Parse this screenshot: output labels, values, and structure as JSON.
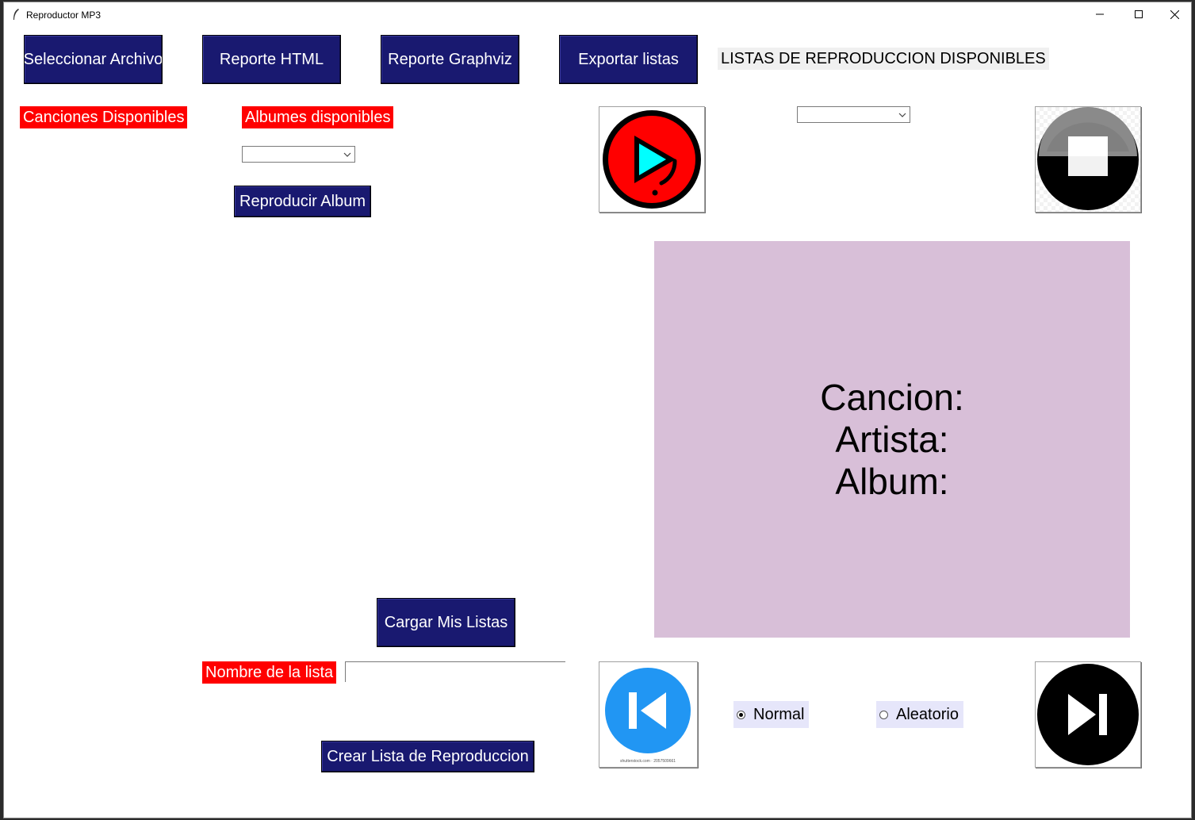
{
  "window": {
    "title": "Reproductor MP3",
    "controls": {
      "minimize": "—",
      "maximize": "☐",
      "close": "✕"
    }
  },
  "toolbar": {
    "select_file": "Seleccionar Archivo",
    "html_report": "Reporte HTML",
    "graphviz_report": "Reporte Graphviz",
    "export_lists": "Exportar listas"
  },
  "playlists_header": "LISTAS DE REPRODUCCION DISPONIBLES",
  "songs_label": "Canciones Disponibles",
  "albums_label": "Albumes disponibles",
  "albums_combo_value": "",
  "playlists_combo_value": "",
  "play_album_button": "Reproducir Album",
  "now_playing": {
    "song_label": "Cancion:",
    "artist_label": "Artista:",
    "album_label": "Album:"
  },
  "load_lists_button": "Cargar Mis Listas",
  "list_name_label": "Nombre de la lista",
  "list_name_value": "",
  "create_list_button": "Crear Lista de Reproduccion",
  "mode": {
    "normal_label": "Normal",
    "random_label": "Aleatorio",
    "selected": "normal"
  },
  "prev_image_caption": "shutterstock.com · 2057509661",
  "colors": {
    "button_bg": "#191970",
    "label_red": "#ff0000",
    "info_panel": "#d8bfd8",
    "radio_bg": "#e6e6fa"
  },
  "icons": [
    "feather-icon",
    "play-icon",
    "stop-icon",
    "previous-icon",
    "next-icon",
    "chevron-down-icon"
  ]
}
